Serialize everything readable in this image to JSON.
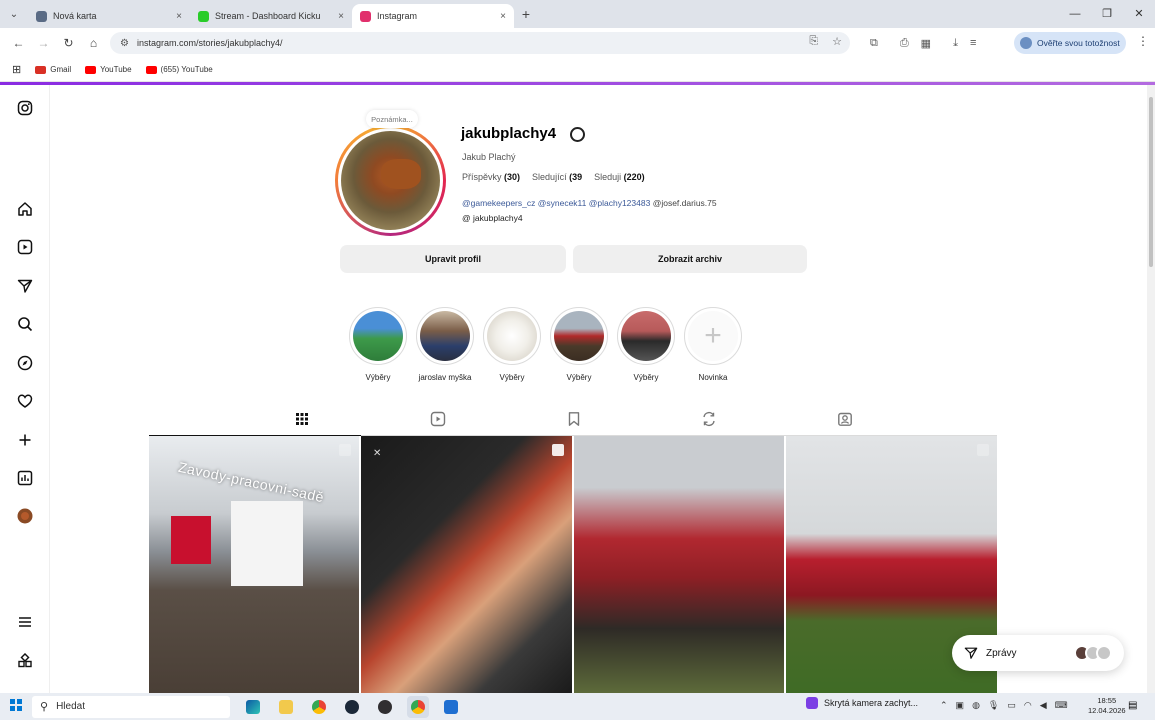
{
  "browser": {
    "tabs": [
      {
        "title": "Nová karta",
        "close": "×",
        "color": "#5a6b85"
      },
      {
        "title": "Stream - Dashboard Kicku",
        "close": "×",
        "color": "#29cc29"
      },
      {
        "title": "Instagram",
        "close": "×",
        "color": "#e1306c"
      }
    ],
    "new_tab": "+",
    "window_controls": [
      "—",
      "❐",
      "✕"
    ],
    "url": "instagram.com/stories/jakubplachy4/",
    "verify_label": "Ověřte svou totožnost",
    "bookmarks": [
      {
        "label": "Gmail",
        "color": "#d93025"
      },
      {
        "label": "YouTube",
        "color": "#ff0000"
      },
      {
        "label": "(655) YouTube",
        "color": "#ff0000"
      }
    ]
  },
  "profile": {
    "note": "Poznámka...",
    "username": "jakubplachy4",
    "full_name": "Jakub Plachý",
    "stats": [
      {
        "label": "Příspěvky",
        "value": "(30)"
      },
      {
        "label": "Sledující",
        "value": "(39"
      },
      {
        "label": "Sleduji",
        "value": "(220)"
      }
    ],
    "mentions": [
      "@gamekeepers_cz",
      "@synecek11",
      "@plachy123483"
    ],
    "mention_dark": "@josef.darius.75",
    "threads_handle": "jakubplachy4",
    "edit_button": "Upravit profil",
    "archive_button": "Zobrazit archiv"
  },
  "highlights": [
    {
      "label": "Výběry"
    },
    {
      "label": "jaroslav myška"
    },
    {
      "label": "Výběry"
    },
    {
      "label": "Výběry"
    },
    {
      "label": "Výběry"
    },
    {
      "label": "Novinka"
    }
  ],
  "posts": [
    {
      "overlay": "Zavody-pracovni-sadě"
    }
  ],
  "messages": {
    "label": "Zprávy"
  },
  "taskbar": {
    "search": "Hledat",
    "notification": "Skrytá kamera zachyt...",
    "time": "18:55",
    "date": "12.04.2026"
  }
}
